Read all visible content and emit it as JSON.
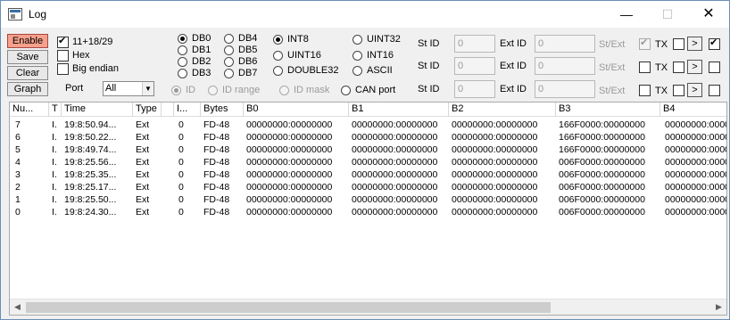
{
  "window": {
    "title": "Log",
    "min_glyph": "—",
    "max_glyph": "☐",
    "close_glyph": "✕"
  },
  "buttons": {
    "enable": "Enable",
    "save": "Save",
    "clear": "Clear",
    "graph": "Graph"
  },
  "options": {
    "ext_id": {
      "label": "11+18/29",
      "checked": true
    },
    "hex": {
      "label": "Hex",
      "checked": false
    },
    "big_endian": {
      "label": "Big endian",
      "checked": false
    },
    "port_label": "Port",
    "port_value": "All",
    "port_arrow": "▼"
  },
  "db_radios": [
    "DB0",
    "DB1",
    "DB2",
    "DB3",
    "DB4",
    "DB5",
    "DB6",
    "DB7"
  ],
  "type_radios": [
    "INT8",
    "UINT16",
    "DOUBLE32",
    "UINT32",
    "INT16",
    "ASCII"
  ],
  "filter_radios": [
    "ID",
    "ID range",
    "ID mask",
    "CAN port"
  ],
  "filters": {
    "st_id_label": "St ID",
    "ext_id_label": "Ext ID",
    "id_value": "0",
    "st_ext_label": "St/Ext",
    "tx_label": "TX",
    "arrow_label": ">"
  },
  "table": {
    "headers": [
      "Nu...",
      "T",
      "Time",
      "Type",
      "",
      "I...",
      "Bytes",
      "B0",
      "B1",
      "B2",
      "B3",
      "B4"
    ],
    "rows": [
      [
        "7",
        "I.",
        "19:8:50.94...",
        "Ext",
        "0",
        "FD-48",
        "00000000:00000000",
        "00000000:00000000",
        "00000000:00000000",
        "166F0000:00000000",
        "00000000:000000"
      ],
      [
        "6",
        "I.",
        "19:8:50.22...",
        "Ext",
        "0",
        "FD-48",
        "00000000:00000000",
        "00000000:00000000",
        "00000000:00000000",
        "166F0000:00000000",
        "00000000:000000"
      ],
      [
        "5",
        "I.",
        "19:8:49.74...",
        "Ext",
        "0",
        "FD-48",
        "00000000:00000000",
        "00000000:00000000",
        "00000000:00000000",
        "166F0000:00000000",
        "00000000:000000"
      ],
      [
        "4",
        "I.",
        "19:8:25.56...",
        "Ext",
        "0",
        "FD-48",
        "00000000:00000000",
        "00000000:00000000",
        "00000000:00000000",
        "006F0000:00000000",
        "00000000:000000"
      ],
      [
        "3",
        "I.",
        "19:8:25.35...",
        "Ext",
        "0",
        "FD-48",
        "00000000:00000000",
        "00000000:00000000",
        "00000000:00000000",
        "006F0000:00000000",
        "00000000:000000"
      ],
      [
        "2",
        "I.",
        "19:8:25.17...",
        "Ext",
        "0",
        "FD-48",
        "00000000:00000000",
        "00000000:00000000",
        "00000000:00000000",
        "006F0000:00000000",
        "00000000:000000"
      ],
      [
        "1",
        "I.",
        "19:8:25.50...",
        "Ext",
        "0",
        "FD-48",
        "00000000:00000000",
        "00000000:00000000",
        "00000000:00000000",
        "006F0000:00000000",
        "00000000:000000"
      ],
      [
        "0",
        "I.",
        "19:8:24.30...",
        "Ext",
        "0",
        "FD-48",
        "00000000:00000000",
        "00000000:00000000",
        "00000000:00000000",
        "006F0000:00000000",
        "00000000:000000"
      ]
    ]
  },
  "scrollbar": {
    "left_arrow": "◀",
    "right_arrow": "▶"
  },
  "colors": {
    "enable_button": "#f5a08b",
    "window_border": "#6a8fb8"
  }
}
